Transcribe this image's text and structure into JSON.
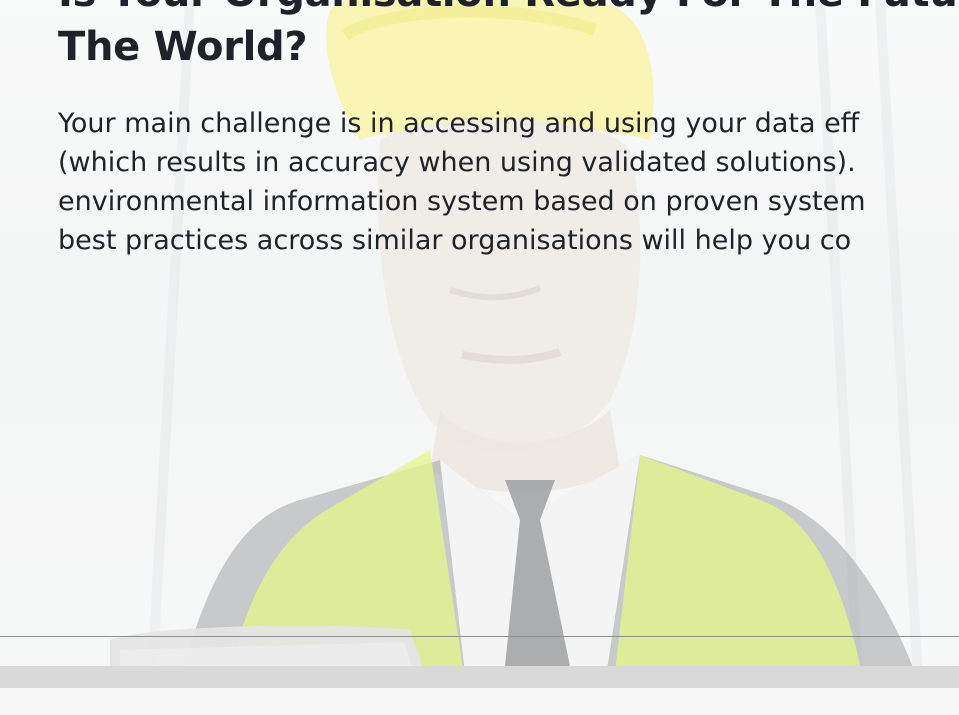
{
  "hero": {
    "headline_lines": [
      "Is Your Organisation Ready For The Future Of",
      "The World?"
    ],
    "body_lines": [
      "Your main challenge is in accessing and using your data eff",
      "(which results in accuracy when using validated solutions).",
      "environmental information system based on proven system",
      "best practices across similar organisations will help you co"
    ]
  },
  "colors": {
    "text": "#1f2329",
    "helmet": "#f2e94a",
    "vest": "#d8f24a",
    "divider": "#8e9090"
  },
  "icons": {
    "background": "construction-worker-with-laptop-image"
  }
}
